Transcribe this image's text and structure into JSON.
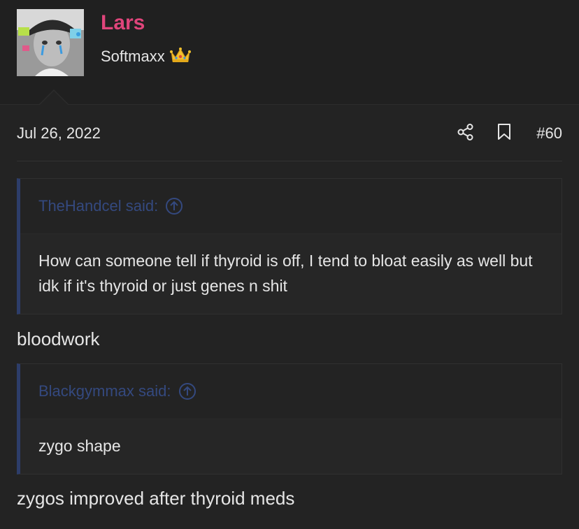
{
  "user": {
    "name": "Lars",
    "title": "Softmaxx",
    "avatar_icon": "user-avatar"
  },
  "post": {
    "date": "Jul 26, 2022",
    "number": "#60",
    "share_icon": "share-icon",
    "bookmark_icon": "bookmark-icon"
  },
  "quotes": [
    {
      "author_label": "TheHandcel said:",
      "text": "How can someone tell if thyroid is off, I tend to bloat easily as well but idk if it's thyroid or just genes n shit"
    },
    {
      "author_label": "Blackgymmax said:",
      "text": "zygo shape"
    }
  ],
  "replies": [
    "bloodwork",
    "zygos improved after thyroid meds"
  ],
  "colors": {
    "username": "#e0457b",
    "quote_attrib": "#34497f",
    "quote_border": "#2d3d6a",
    "background": "#232323"
  }
}
